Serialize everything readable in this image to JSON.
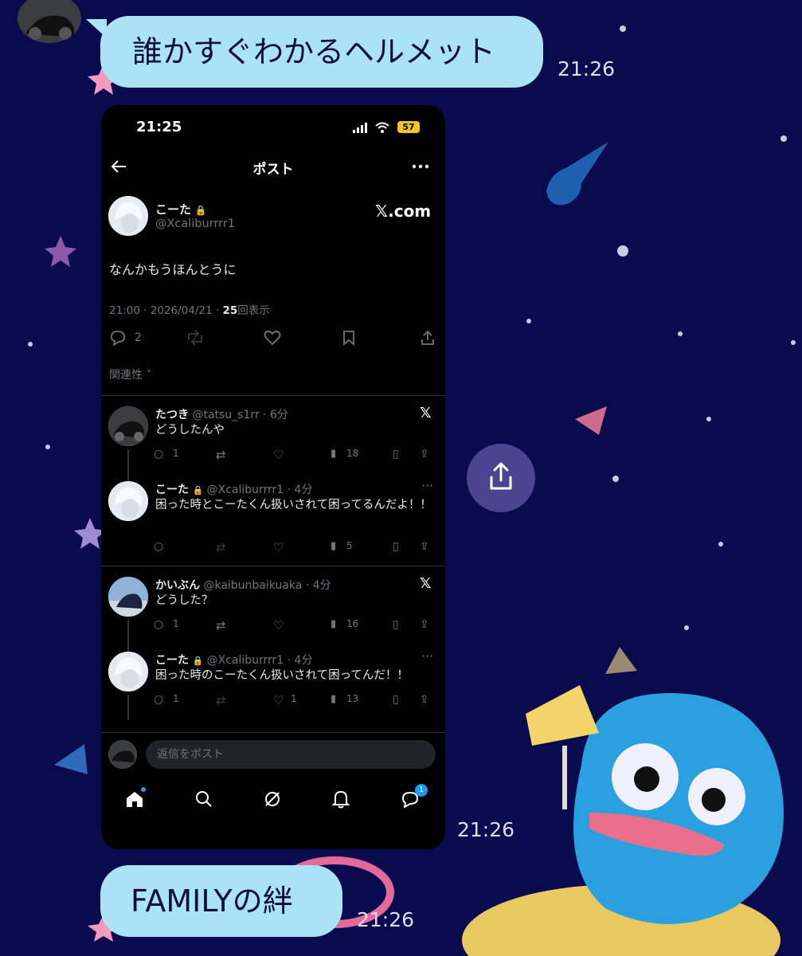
{
  "chat": {
    "messages": [
      {
        "text": "誰かすぐわかるヘルメット",
        "time": "21:26"
      },
      {
        "time": "21:26"
      },
      {
        "text": "FAMILYの絆",
        "time": "21:26"
      }
    ]
  },
  "screenshot": {
    "status_time": "21:25",
    "battery": "57",
    "nav_title": "ポスト",
    "post": {
      "author_name": "こーた",
      "author_handle": "@Xcaliburrrr1",
      "source": "𝕏.com",
      "body": "なんかもうほんとうに",
      "meta_time": "21:00 · 2026/04/21 · ",
      "meta_views": "25",
      "meta_views_label": "回表示",
      "reply_count": "2",
      "sort_label": "関連性"
    },
    "replies": [
      {
        "name": "たつき",
        "handle": "@tatsu_s1rr · 6分",
        "text": "どうしたんや",
        "replies": "1",
        "likes": "",
        "views": "18"
      },
      {
        "name": "こーた",
        "handle": "@Xcaliburrrr1 · 4分",
        "text": "困った時とこーたくん扱いされて困ってるんだよ！！",
        "replies": "",
        "likes": "",
        "views": "5"
      },
      {
        "name": "かいぶん",
        "handle": "@kaibunbaikuaka · 4分",
        "text": "どうした？",
        "replies": "1",
        "likes": "",
        "views": "16"
      },
      {
        "name": "こーた",
        "handle": "@Xcaliburrrr1 · 4分",
        "text": "困った時のこーたくん扱いされて困ってんだ！！",
        "replies": "1",
        "likes": "1",
        "views": "13"
      }
    ],
    "compose_placeholder": "返信をポスト",
    "tabs": [
      "home",
      "search",
      "grok",
      "notifications",
      "messages"
    ],
    "messages_badge": "1"
  },
  "colors": {
    "background": "#0a0a4e",
    "bubble": "#a9e3f5",
    "phone_bg": "#000000",
    "accent_blue": "#1d9bf0"
  }
}
